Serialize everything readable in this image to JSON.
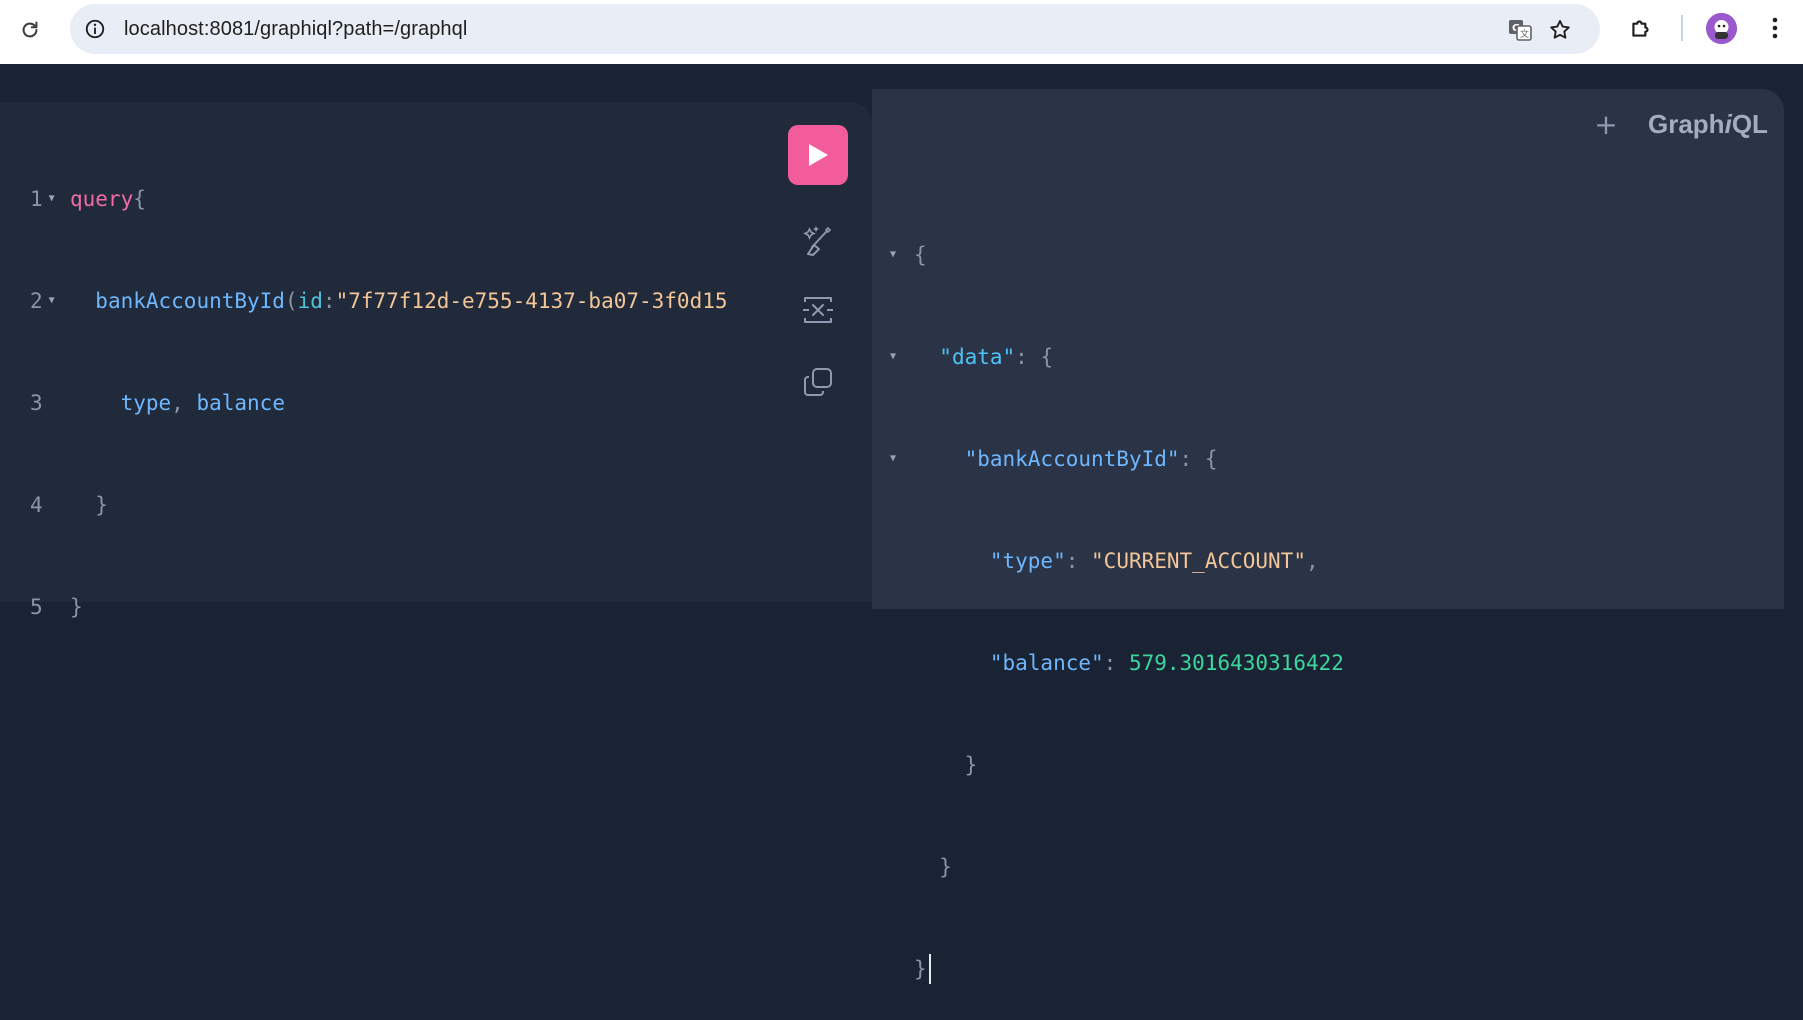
{
  "browser": {
    "url": "localhost:8081/graphiql?path=/graphql",
    "icons": [
      "reload-icon",
      "site-info-icon",
      "translate-icon",
      "bookmark-star-icon",
      "extensions-icon",
      "profile-avatar",
      "menu-kebab-icon"
    ]
  },
  "graphiql": {
    "logo_prefix": "Graph",
    "logo_italic": "i",
    "logo_suffix": "QL",
    "add_tab_label": "+",
    "line_numbers": [
      "1",
      "2",
      "3",
      "4",
      "5"
    ],
    "query": {
      "keyword": "query",
      "open_brace": "{",
      "field": "bankAccountById",
      "open_paren": "(",
      "arg_name": "id",
      "colon": ":",
      "arg_value": "\"7f77f12d-e755-4137-ba07-3f0d15",
      "sub_field_1": "type",
      "comma": ",",
      "sub_field_2": "balance",
      "inner_close": "}",
      "outer_close": "}"
    },
    "result": {
      "open": "{",
      "data_key": "\"data\"",
      "account_key": "\"bankAccountById\"",
      "type_key": "\"type\"",
      "type_value": "\"CURRENT_ACCOUNT\"",
      "balance_key": "\"balance\"",
      "balance_value": "579.3016430316422",
      "close": "}",
      "colon": ":",
      "comma": ","
    },
    "toolbar_icons": [
      "run-icon",
      "prettify-icon",
      "merge-icon",
      "copy-icon"
    ],
    "colors": {
      "run_button": "#f25c9b",
      "background": "#192333",
      "editor": "#202a3a",
      "result": "#2a3446"
    }
  }
}
